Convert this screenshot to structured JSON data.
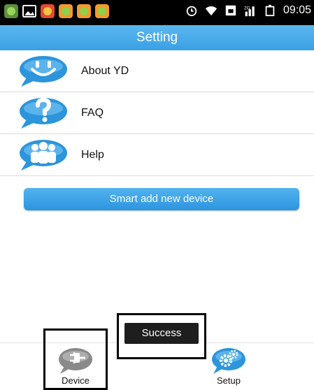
{
  "status_bar": {
    "time": "09:05",
    "network": "2G",
    "icons": [
      "notification-icon",
      "image-icon",
      "app-icon",
      "app-icon",
      "app-icon",
      "app-icon",
      "alarm-icon",
      "wifi-icon",
      "sim-icon",
      "signal-icon",
      "battery-icon"
    ]
  },
  "header": {
    "title": "Setting"
  },
  "menu": {
    "items": [
      {
        "label": "About YD",
        "icon": "smiley-bubble-icon"
      },
      {
        "label": "FAQ",
        "icon": "question-bubble-icon"
      },
      {
        "label": "Help",
        "icon": "people-bubble-icon"
      }
    ]
  },
  "actions": {
    "smart_add_label": "Smart add new device"
  },
  "toast": {
    "text": "Success"
  },
  "tabs": [
    {
      "label": "Device",
      "icon": "plug-bubble-icon"
    },
    {
      "label": "Setup",
      "icon": "gears-bubble-icon"
    }
  ],
  "colors": {
    "accent": "#3aa0e4",
    "status_bar": "#000000",
    "toast_bg": "#1e1e1e"
  }
}
